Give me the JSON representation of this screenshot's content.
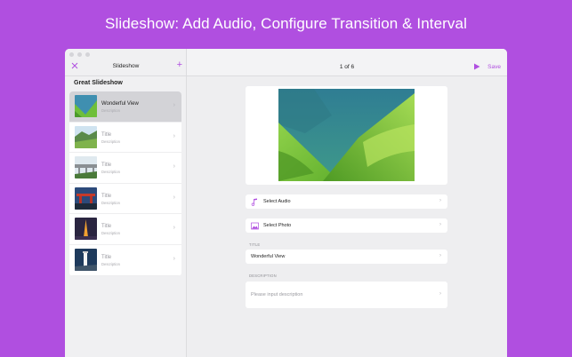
{
  "headline": "Slideshow: Add Audio, Configure Transition & Interval",
  "colors": {
    "accent": "#b04fe0",
    "background": "#b04fe0"
  },
  "sidebar": {
    "title": "Slideshow",
    "close_icon": "close-icon",
    "add_icon": "plus-icon",
    "group_title": "Great Slideshow",
    "items": [
      {
        "title": "Wonderful View",
        "description": "Description",
        "thumb": "green-valley",
        "selected": true
      },
      {
        "title": "Title",
        "description": "Description",
        "thumb": "mountain-meadow",
        "selected": false
      },
      {
        "title": "Title",
        "description": "Description",
        "thumb": "bridge",
        "selected": false
      },
      {
        "title": "Title",
        "description": "Description",
        "thumb": "red-gate",
        "selected": false
      },
      {
        "title": "Title",
        "description": "Description",
        "thumb": "eiffel-night",
        "selected": false
      },
      {
        "title": "Title",
        "description": "Description",
        "thumb": "lighthouse",
        "selected": false
      }
    ]
  },
  "main": {
    "pager": "1 of 6",
    "play_icon": "play-icon",
    "save_label": "Save",
    "select_audio_label": "Select Audio",
    "select_photo_label": "Select Photo",
    "title_field_label": "TITLE",
    "title_value": "Wonderful View",
    "description_field_label": "DESCRIPTION",
    "description_placeholder": "Please input description"
  }
}
